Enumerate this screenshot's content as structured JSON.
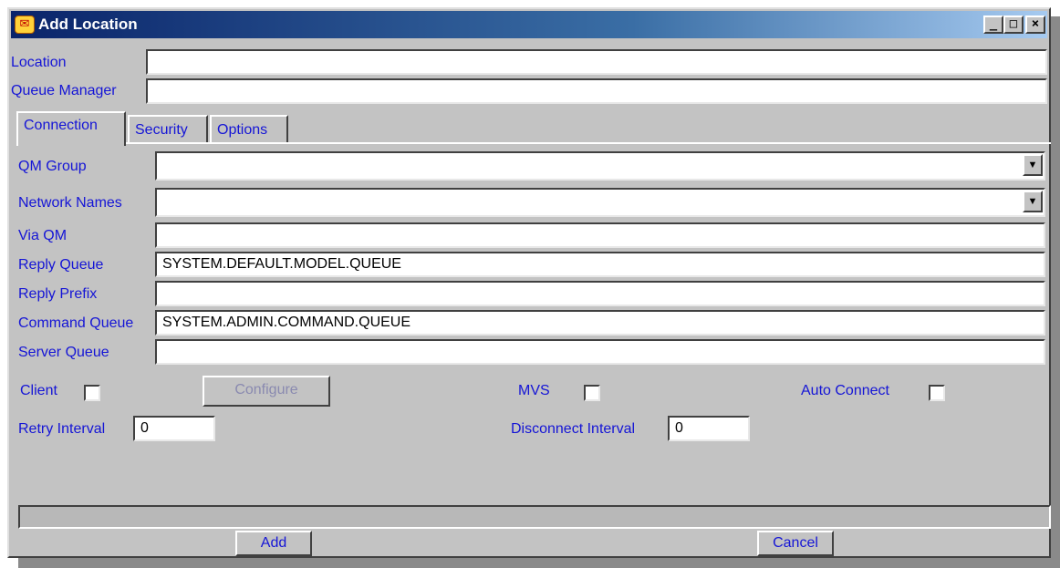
{
  "window": {
    "title": "Add Location",
    "minimize_glyph": "_",
    "maximize_glyph": "□",
    "close_glyph": "×",
    "icon": "envelope-app-icon"
  },
  "top_fields": {
    "location_label": "Location",
    "location_value": "",
    "queue_manager_label": "Queue Manager",
    "queue_manager_value": ""
  },
  "tabs": [
    {
      "label": "Connection",
      "active": true
    },
    {
      "label": "Security",
      "active": false
    },
    {
      "label": "Options",
      "active": false
    }
  ],
  "connection": {
    "qm_group_label": "QM Group",
    "qm_group_value": "",
    "network_names_label": "Network Names",
    "network_names_value": "",
    "via_qm_label": "Via QM",
    "via_qm_value": "",
    "reply_queue_label": "Reply Queue",
    "reply_queue_value": "SYSTEM.DEFAULT.MODEL.QUEUE",
    "reply_prefix_label": "Reply Prefix",
    "reply_prefix_value": "",
    "command_queue_label": "Command Queue",
    "command_queue_value": "SYSTEM.ADMIN.COMMAND.QUEUE",
    "server_queue_label": "Server Queue",
    "server_queue_value": "",
    "client_label": "Client",
    "client_checked": false,
    "configure_label": "Configure",
    "mvs_label": "MVS",
    "mvs_checked": false,
    "auto_connect_label": "Auto Connect",
    "auto_connect_checked": false,
    "retry_interval_label": "Retry Interval",
    "retry_interval_value": "0",
    "disconnect_interval_label": "Disconnect Interval",
    "disconnect_interval_value": "0"
  },
  "status_text": "",
  "buttons": {
    "add_label": "Add",
    "cancel_label": "Cancel"
  },
  "colors": {
    "label_text": "#1515d6",
    "face": "#c3c3c3",
    "title_start": "#0a246a",
    "title_end": "#a6caf0"
  }
}
